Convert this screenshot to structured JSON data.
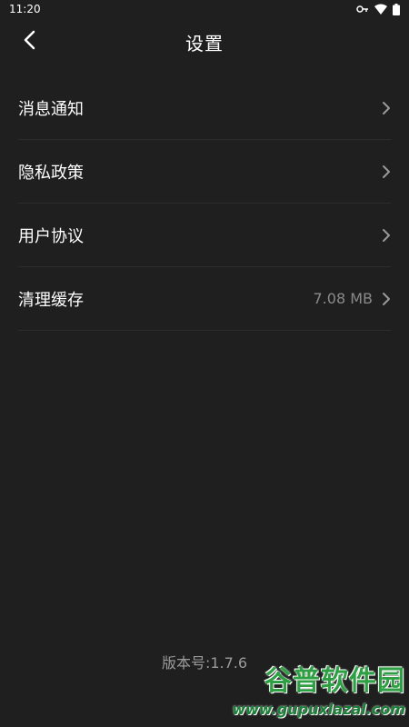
{
  "status_bar": {
    "time": "11:20",
    "icons": [
      "key-icon",
      "wifi-icon",
      "battery-icon"
    ]
  },
  "header": {
    "title": "设置",
    "back_icon": "chevron-left-icon"
  },
  "settings": {
    "items": [
      {
        "label": "消息通知",
        "value": ""
      },
      {
        "label": "隐私政策",
        "value": ""
      },
      {
        "label": "用户协议",
        "value": ""
      },
      {
        "label": "清理缓存",
        "value": "7.08 MB"
      }
    ]
  },
  "footer": {
    "version": "版本号:1.7.6"
  },
  "watermark": {
    "logo": "谷普软件园",
    "url": "www.gupuxlazal.com"
  },
  "colors": {
    "background": "#1f1f1f",
    "divider": "#2c2c2c",
    "muted_text": "#8a8a8a",
    "watermark_green": "#2ea043"
  }
}
